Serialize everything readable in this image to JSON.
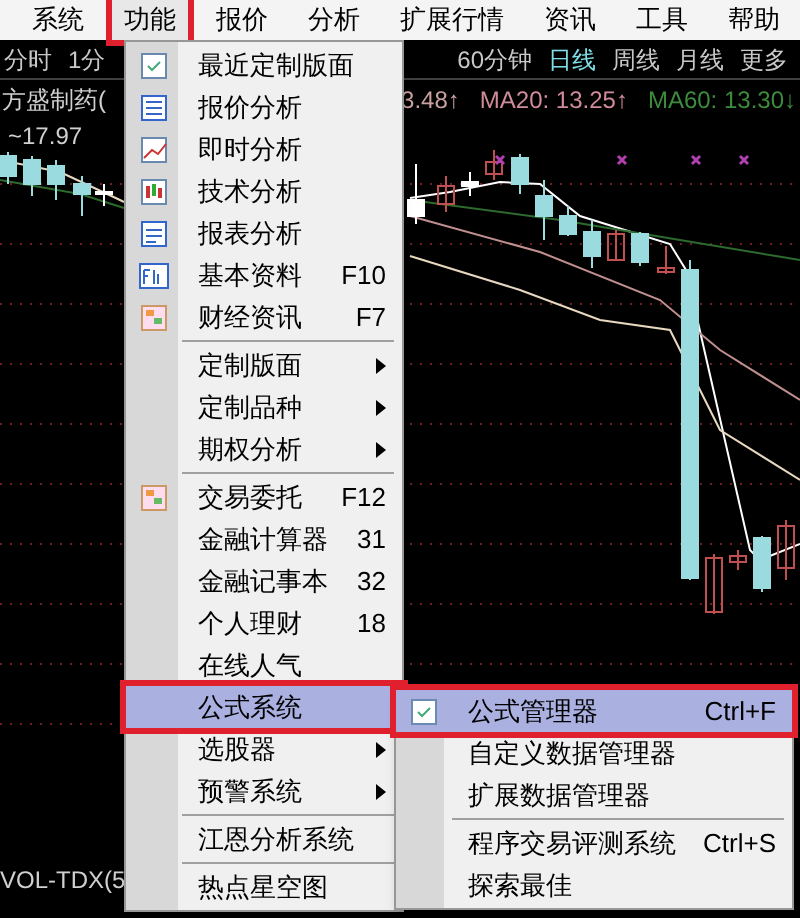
{
  "menubar": [
    {
      "label": "系统",
      "selected": false
    },
    {
      "label": "功能",
      "selected": true
    },
    {
      "label": "报价",
      "selected": false
    },
    {
      "label": "分析",
      "selected": false
    },
    {
      "label": "扩展行情",
      "selected": false
    },
    {
      "label": "资讯",
      "selected": false
    },
    {
      "label": "工具",
      "selected": false
    },
    {
      "label": "帮助",
      "selected": false
    }
  ],
  "period_bar": {
    "left": [
      {
        "label": "分时",
        "selected": false
      },
      {
        "label": "1分",
        "selected": false
      }
    ],
    "right": [
      {
        "label": "60分钟",
        "selected": false
      },
      {
        "label": "日线",
        "selected": true
      },
      {
        "label": "周线",
        "selected": false
      },
      {
        "label": "月线",
        "selected": false
      },
      {
        "label": "更多",
        "selected": false
      }
    ]
  },
  "chart": {
    "title": "方盛制药(",
    "price_label": "~17.97",
    "indicators": [
      {
        "text": "3.48↑",
        "color": "#c8a0a0"
      },
      {
        "text": "MA20: 13.25↑",
        "color": "#d08c9c"
      },
      {
        "text": "MA60: 13.30↓",
        "color": "#3c8c3c"
      }
    ],
    "volume_label": "VOL-TDX(5"
  },
  "menu": [
    {
      "kind": "item",
      "label": "最近定制版面",
      "icon": true,
      "selected": false
    },
    {
      "kind": "item",
      "label": "报价分析",
      "icon": true,
      "selected": false
    },
    {
      "kind": "item",
      "label": "即时分析",
      "icon": true,
      "selected": false
    },
    {
      "kind": "item",
      "label": "技术分析",
      "icon": true,
      "selected": false
    },
    {
      "kind": "item",
      "label": "报表分析",
      "icon": true,
      "selected": false
    },
    {
      "kind": "item",
      "label": "基本资料",
      "shortcut": "F10",
      "icon": true,
      "selected": false
    },
    {
      "kind": "item",
      "label": "财经资讯",
      "shortcut": "F7",
      "icon": true,
      "selected": false
    },
    {
      "kind": "separator"
    },
    {
      "kind": "submenu",
      "label": "定制版面",
      "selected": false
    },
    {
      "kind": "submenu",
      "label": "定制品种",
      "selected": false
    },
    {
      "kind": "submenu",
      "label": "期权分析",
      "selected": false
    },
    {
      "kind": "separator"
    },
    {
      "kind": "item",
      "label": "交易委托",
      "shortcut": "F12",
      "icon": true,
      "selected": false
    },
    {
      "kind": "item",
      "label": "金融计算器",
      "shortcut": "31",
      "selected": false
    },
    {
      "kind": "item",
      "label": "金融记事本",
      "shortcut": "32",
      "selected": false
    },
    {
      "kind": "item",
      "label": "个人理财",
      "shortcut": "18",
      "selected": false
    },
    {
      "kind": "item",
      "label": "在线人气",
      "selected": false
    },
    {
      "kind": "item",
      "label": "公式系统",
      "selected": true
    },
    {
      "kind": "submenu",
      "label": "选股器",
      "selected": false
    },
    {
      "kind": "submenu",
      "label": "预警系统",
      "selected": false
    },
    {
      "kind": "separator"
    },
    {
      "kind": "item",
      "label": "江恩分析系统",
      "selected": false
    },
    {
      "kind": "separator"
    },
    {
      "kind": "item",
      "label": "热点星空图",
      "selected": false
    }
  ],
  "submenu": [
    {
      "kind": "item",
      "label": "公式管理器",
      "shortcut": "Ctrl+F",
      "icon": true,
      "selected": true
    },
    {
      "kind": "item",
      "label": "自定义数据管理器",
      "selected": false
    },
    {
      "kind": "item",
      "label": "扩展数据管理器",
      "selected": false
    },
    {
      "kind": "separator"
    },
    {
      "kind": "item",
      "label": "程序交易评测系统",
      "shortcut": "Ctrl+S",
      "selected": false
    },
    {
      "kind": "item",
      "label": "探索最佳",
      "selected": false
    }
  ]
}
